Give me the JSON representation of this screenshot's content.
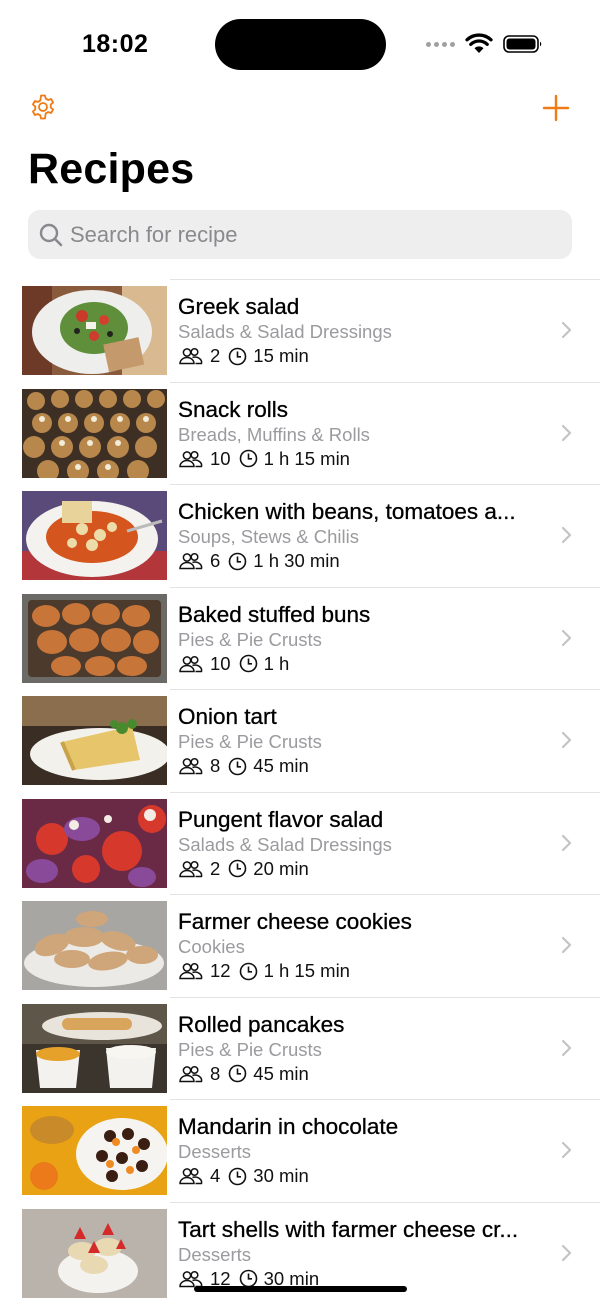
{
  "status": {
    "time": "18:02"
  },
  "header": {
    "title": "Recipes"
  },
  "search": {
    "placeholder": "Search for recipe",
    "value": ""
  },
  "recipes": [
    {
      "name": "Greek salad",
      "category": "Salads & Salad Dressings",
      "servings": "2",
      "time": "15 min"
    },
    {
      "name": "Snack rolls",
      "category": "Breads, Muffins & Rolls",
      "servings": "10",
      "time": "1 h 15 min"
    },
    {
      "name": "Chicken with beans, tomatoes a...",
      "category": "Soups, Stews & Chilis",
      "servings": "6",
      "time": "1 h 30 min"
    },
    {
      "name": "Baked stuffed buns",
      "category": "Pies & Pie Crusts",
      "servings": "10",
      "time": "1 h"
    },
    {
      "name": "Onion tart",
      "category": "Pies & Pie Crusts",
      "servings": "8",
      "time": "45 min"
    },
    {
      "name": "Pungent flavor salad",
      "category": "Salads & Salad Dressings",
      "servings": "2",
      "time": "20 min"
    },
    {
      "name": "Farmer cheese cookies",
      "category": "Cookies",
      "servings": "12",
      "time": "1 h 15 min"
    },
    {
      "name": "Rolled pancakes",
      "category": "Pies & Pie Crusts",
      "servings": "8",
      "time": "45 min"
    },
    {
      "name": "Mandarin in chocolate",
      "category": "Desserts",
      "servings": "4",
      "time": "30 min"
    },
    {
      "name": "Tart shells with farmer cheese cr...",
      "category": "Desserts",
      "servings": "12",
      "time": "30 min"
    }
  ],
  "colors": {
    "accent": "#f07a16",
    "secondary_text": "#9b9b9f",
    "search_bg": "#eeeeef"
  },
  "icons": {
    "settings": "gear-icon",
    "add": "plus-icon",
    "search": "magnifier-icon",
    "servings": "people-icon",
    "duration": "clock-icon",
    "disclosure": "chevron-right-icon"
  }
}
